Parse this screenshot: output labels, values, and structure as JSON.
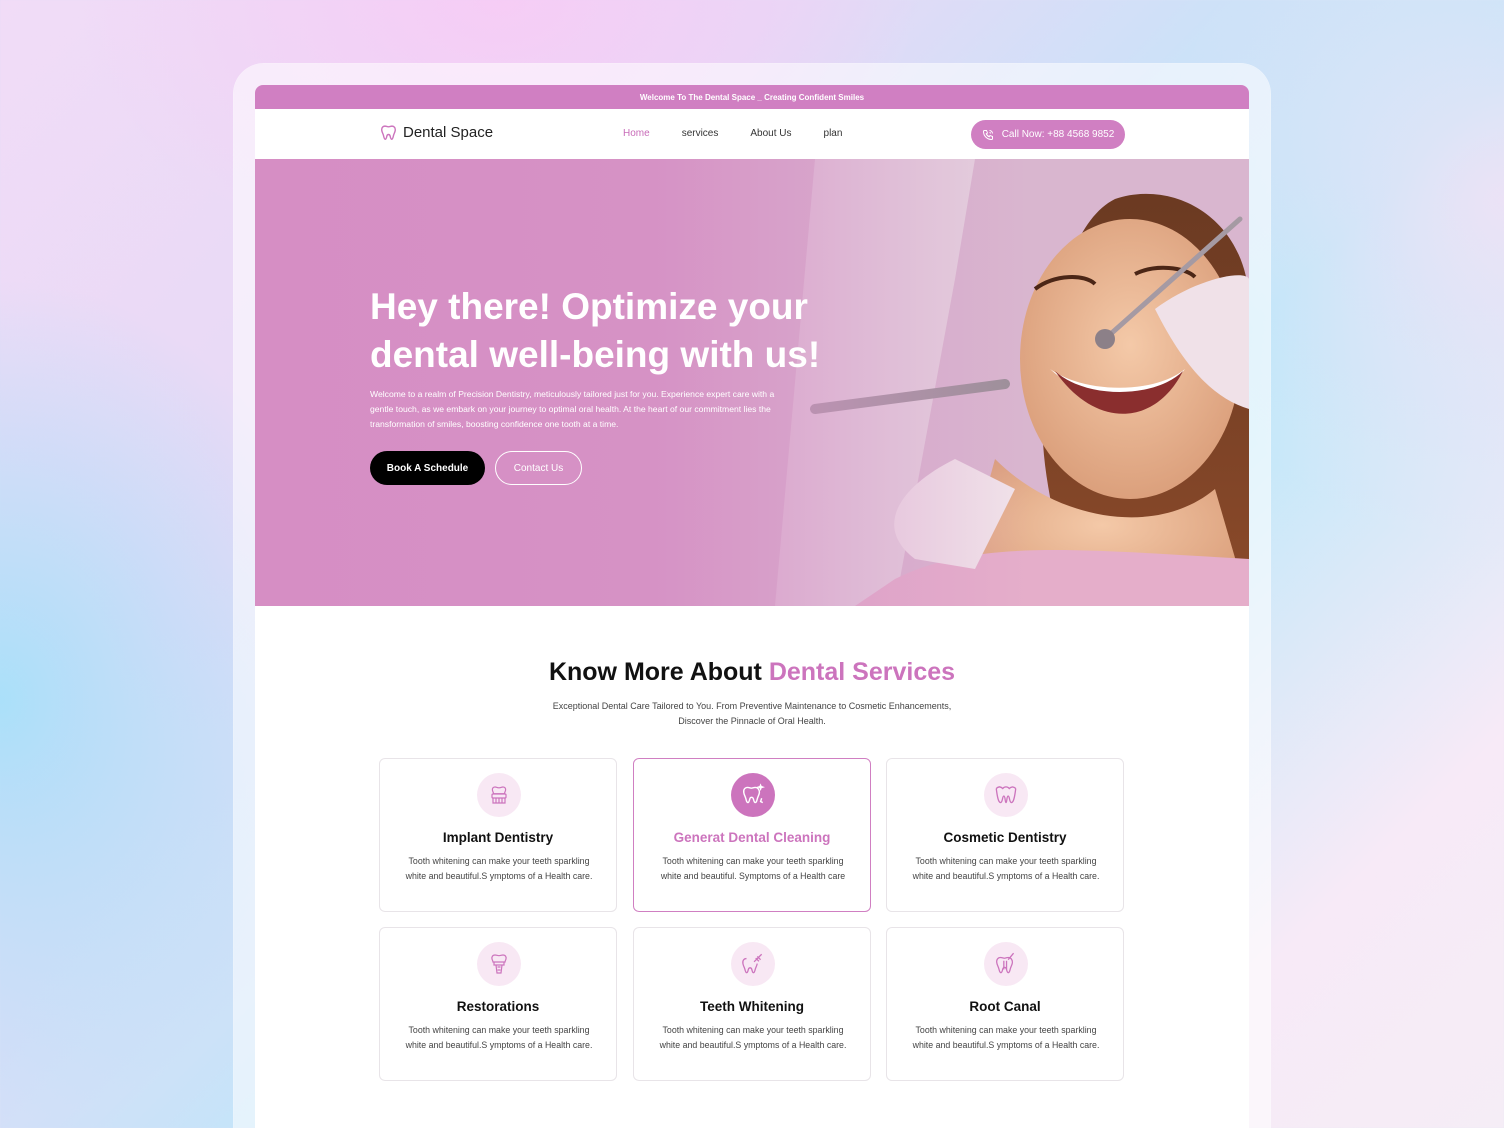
{
  "topbar": {
    "text": "Welcome To The Dental Space _ Creating Confident Smiles"
  },
  "brand": {
    "name": "Dental Space",
    "icon": "tooth-icon"
  },
  "nav": {
    "items": [
      {
        "label": "Home",
        "active": true
      },
      {
        "label": "services",
        "active": false
      },
      {
        "label": "About Us",
        "active": false
      },
      {
        "label": "plan",
        "active": false
      }
    ],
    "call_label": "Call Now: +88 4568 9852",
    "call_icon": "phone-icon"
  },
  "hero": {
    "title": "Hey there! Optimize your dental well-being with us!",
    "description": "Welcome to a realm of Precision Dentistry, meticulously tailored just for you. Experience expert care with a gentle touch, as we embark on your journey to optimal oral health. At the heart of our commitment lies the transformation of smiles, boosting confidence one tooth at a time.",
    "primary_button": "Book A Schedule",
    "secondary_button": "Contact Us"
  },
  "services": {
    "title_plain": "Know More About ",
    "title_accent": "Dental Services",
    "description": "Exceptional Dental Care Tailored to You. From Preventive Maintenance to Cosmetic Enhancements, Discover the Pinnacle of Oral Health.",
    "cards": [
      {
        "title": "Implant Dentistry",
        "text": "Tooth whitening can make your teeth sparkling white and beautiful.S ymptoms of a Health care.",
        "icon": "implant-icon",
        "active": false
      },
      {
        "title": "Generat Dental Cleaning",
        "text": "Tooth whitening can make your teeth sparkling white and beautiful. Symptoms of a Health care",
        "icon": "tooth-cleaning-icon",
        "active": true
      },
      {
        "title": "Cosmetic Dentistry",
        "text": "Tooth whitening can make your teeth sparkling white and beautiful.S ymptoms of a Health care.",
        "icon": "gum-teeth-icon",
        "active": false
      },
      {
        "title": "Restorations",
        "text": "Tooth whitening can make your teeth sparkling white and beautiful.S ymptoms of a Health care.",
        "icon": "crown-icon",
        "active": false
      },
      {
        "title": "Teeth  Whitening",
        "text": "Tooth whitening can make your teeth sparkling white and beautiful.S ymptoms of a Health care.",
        "icon": "whitening-brush-icon",
        "active": false
      },
      {
        "title": "Root Canal",
        "text": "Tooth whitening can make your teeth sparkling white and beautiful.S ymptoms of a Health care.",
        "icon": "root-canal-icon",
        "active": false
      }
    ]
  },
  "colors": {
    "accent": "#cc74bd",
    "topbar": "#d07fc2",
    "dark_button": "#000000"
  }
}
